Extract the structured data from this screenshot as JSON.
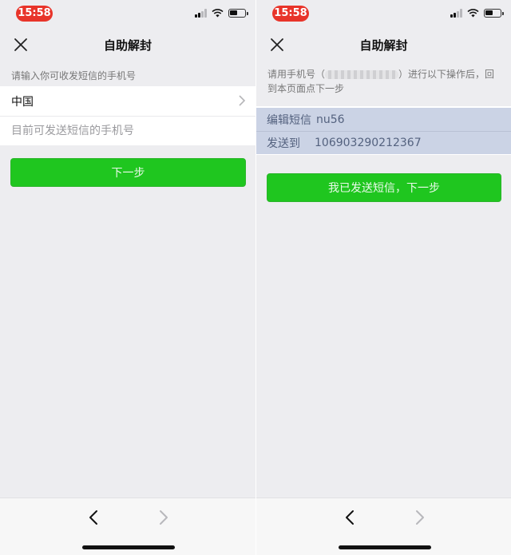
{
  "status": {
    "time": "15:58"
  },
  "left": {
    "title": "自助解封",
    "hint": "请输入你可收发短信的手机号",
    "country": "中国",
    "phone_placeholder": "目前可发送短信的手机号",
    "next_label": "下一步"
  },
  "right": {
    "title": "自助解封",
    "hint_prefix": "请用手机号（",
    "hint_suffix": "）进行以下操作后，回到本页面点下一步",
    "sms": {
      "edit_label": "编辑短信",
      "code": "nu56",
      "to_label": "发送到",
      "number": "106903290212367"
    },
    "confirm_label": "我已发送短信，下一步"
  },
  "colors": {
    "accent_green": "#1fc61f",
    "time_pill": "#e8342a",
    "sms_highlight": "#cbd3e5"
  },
  "icons": [
    "close-icon",
    "chevron-right-icon",
    "back-arrow-icon",
    "forward-arrow-icon",
    "wifi-icon",
    "battery-icon",
    "signal-icon"
  ]
}
